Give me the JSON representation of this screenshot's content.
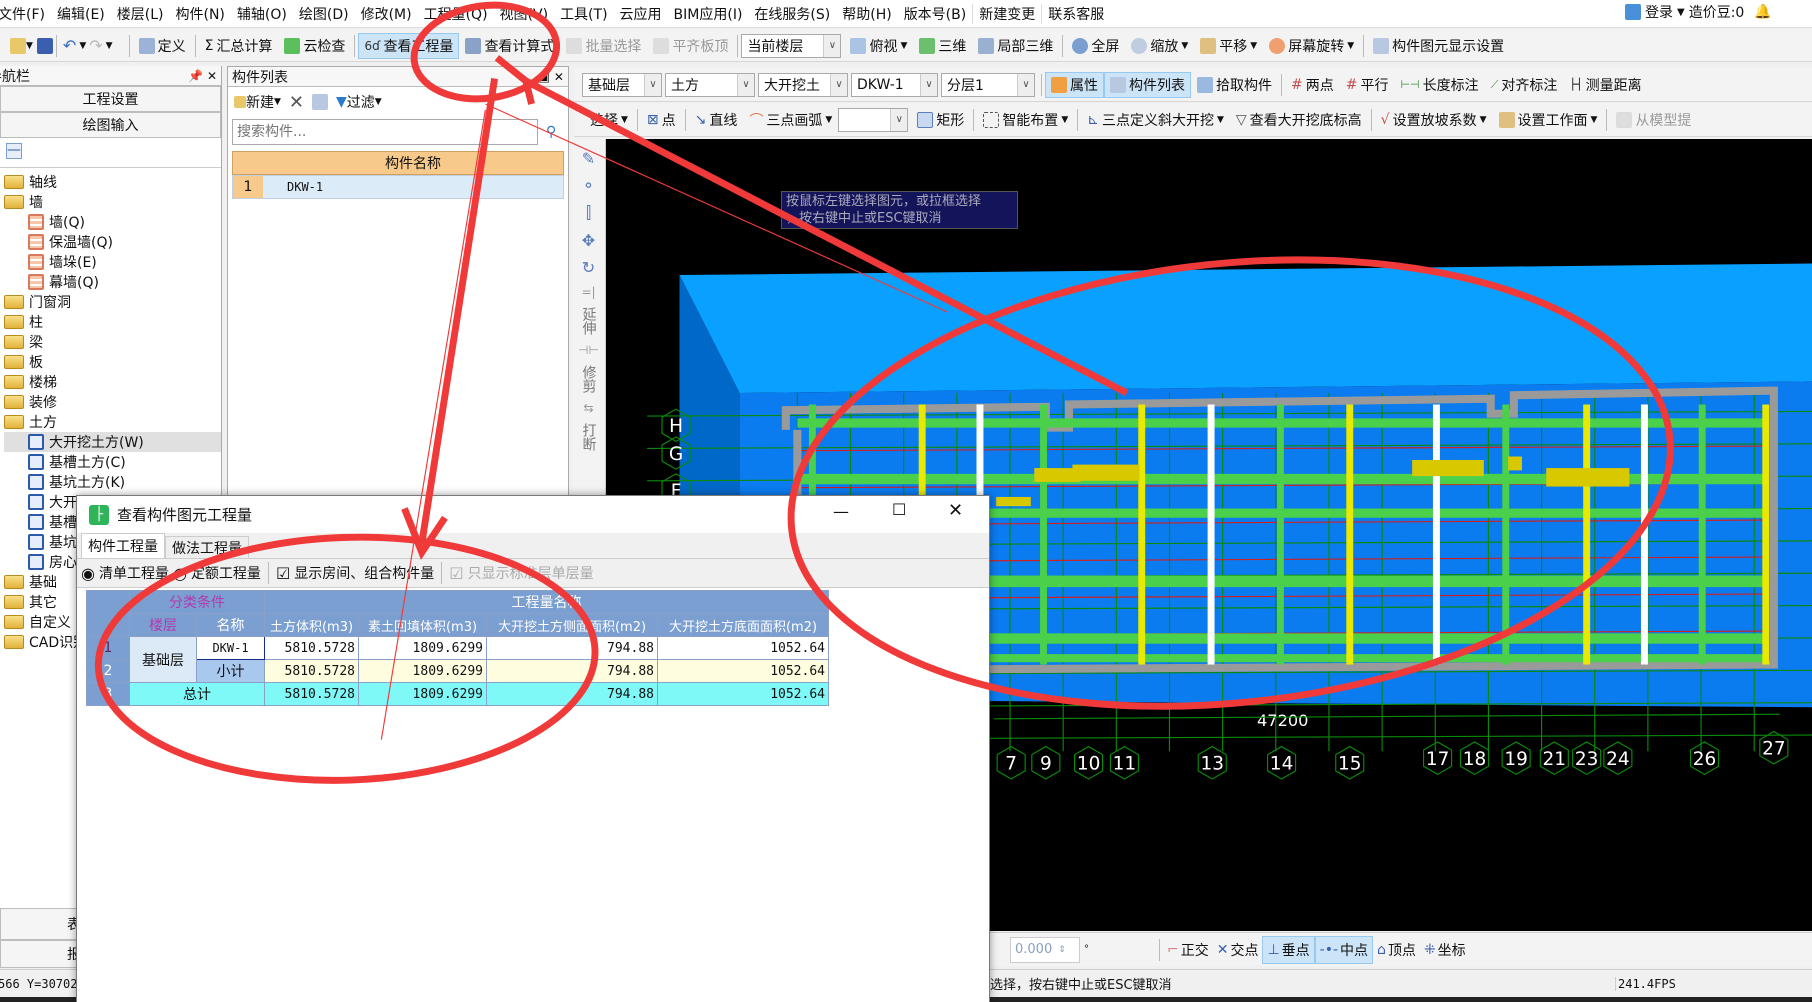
{
  "menu": [
    "文件(F)",
    "编辑(E)",
    "楼层(L)",
    "构件(N)",
    "辅轴(O)",
    "绘图(D)",
    "修改(M)",
    "工程量(Q)",
    "视图(V)",
    "工具(T)",
    "云应用",
    "BIM应用(I)",
    "在线服务(S)",
    "帮助(H)",
    "版本号(B)",
    "新建变更",
    "联系客服"
  ],
  "account": {
    "login": "登录",
    "beans": "造价豆:0"
  },
  "toolbar1": {
    "define": "定义",
    "sum": "汇总计算",
    "cloud_check": "云检查",
    "view_qty": "查看工程量",
    "view_formula": "查看计算式",
    "batch_select": "批量选择",
    "align_top": "平齐板顶",
    "floor_select": "当前楼层",
    "top_view": "俯视",
    "three_d": "三维",
    "partial_3d": "局部三维",
    "fullscreen": "全屏",
    "zoom": "缩放",
    "pan": "平移",
    "rotate": "屏幕旋转",
    "display_settings": "构件图元显示设置"
  },
  "toolbar2": {
    "floor": "基础层",
    "type": "土方",
    "subtype": "大开挖土",
    "component": "DKW-1",
    "layer": "分层1",
    "property": "属性",
    "component_list": "构件列表",
    "pick": "拾取构件",
    "two_points": "两点",
    "parallel": "平行",
    "length_dim": "长度标注",
    "align_dim": "对齐标注",
    "measure": "测量距离"
  },
  "toolbar3": {
    "select": "选择",
    "point": "点",
    "line": "直线",
    "arc": "三点画弧",
    "rect": "矩形",
    "smart": "智能布置",
    "slope": "三点定义斜大开挖",
    "view_bottom": "查看大开挖底标高",
    "slope_coef": "设置放坡系数",
    "work_face": "设置工作面",
    "from_model": "从模型提"
  },
  "nav": {
    "title": "模块导航栏",
    "project_settings": "工程设置",
    "drawing_input": "绘图输入",
    "tree": [
      {
        "label": "轴线",
        "level": 0,
        "kind": "folder"
      },
      {
        "label": "墙",
        "level": 0,
        "kind": "folder"
      },
      {
        "label": "墙(Q)",
        "level": 1,
        "kind": "wall"
      },
      {
        "label": "保温墙(Q)",
        "level": 1,
        "kind": "wall"
      },
      {
        "label": "墙垛(E)",
        "level": 1,
        "kind": "wall"
      },
      {
        "label": "幕墙(Q)",
        "level": 1,
        "kind": "wall"
      },
      {
        "label": "门窗洞",
        "level": 0,
        "kind": "folder"
      },
      {
        "label": "柱",
        "level": 0,
        "kind": "folder"
      },
      {
        "label": "梁",
        "level": 0,
        "kind": "folder"
      },
      {
        "label": "板",
        "level": 0,
        "kind": "folder"
      },
      {
        "label": "楼梯",
        "level": 0,
        "kind": "folder"
      },
      {
        "label": "装修",
        "level": 0,
        "kind": "folder"
      },
      {
        "label": "土方",
        "level": 0,
        "kind": "folder"
      },
      {
        "label": "大开挖土方(W)",
        "level": 1,
        "kind": "leaf",
        "selected": true
      },
      {
        "label": "基槽土方(C)",
        "level": 1,
        "kind": "leaf"
      },
      {
        "label": "基坑土方(K)",
        "level": 1,
        "kind": "leaf"
      },
      {
        "label": "大开",
        "level": 1,
        "kind": "leaf"
      },
      {
        "label": "基槽",
        "level": 1,
        "kind": "leaf"
      },
      {
        "label": "基坑",
        "level": 1,
        "kind": "leaf"
      },
      {
        "label": "房心",
        "level": 1,
        "kind": "leaf"
      },
      {
        "label": "基础",
        "level": 0,
        "kind": "folder"
      },
      {
        "label": "其它",
        "level": 0,
        "kind": "folder"
      },
      {
        "label": "自定义",
        "level": 0,
        "kind": "folder"
      },
      {
        "label": "CAD识别",
        "level": 0,
        "kind": "folder"
      }
    ],
    "bottom_buttons": [
      "表",
      "报"
    ],
    "coords": "566 Y=30702"
  },
  "component_list": {
    "title": "构件列表",
    "new": "新建",
    "filter": "过滤",
    "search_placeholder": "搜索构件...",
    "header": "构件名称",
    "rows": [
      {
        "no": "1",
        "name": "DKW-1"
      }
    ]
  },
  "side_tools": {
    "extend": "延伸",
    "trim": "修剪",
    "break": "打断"
  },
  "canvas": {
    "tooltip_line1": "按鼠标左键选择图元，或拉框选择",
    "tooltip_line2": "，按右键中止或ESC键取消",
    "axis_left": [
      "H",
      "G",
      "F"
    ],
    "axis_bottom": [
      "7",
      "9",
      "10",
      "11",
      "13",
      "14",
      "15",
      "17",
      "18",
      "19",
      "21",
      "23",
      "24",
      "26",
      "27"
    ],
    "dimension": "47200"
  },
  "snap": {
    "angle": "0.000",
    "ortho": "正交",
    "intersection": "交点",
    "perpendicular": "垂点",
    "midpoint": "中点",
    "vertex": "顶点",
    "coordinate": "坐标"
  },
  "status": {
    "message": "选择，按右键中止或ESC键取消",
    "fps": "241.4FPS"
  },
  "dialog": {
    "title": "查看构件图元工程量",
    "tabs": [
      "构件工程量",
      "做法工程量"
    ],
    "opt_list": "清单工程量",
    "opt_quota": "定额工程量",
    "opt_show_room": "显示房间、组合构件量",
    "opt_std_floor": "只显示标准层单层量",
    "table": {
      "group_cond": "分类条件",
      "group_qty": "工程量名称",
      "col_floor": "楼层",
      "col_name": "名称",
      "cols": [
        "土方体积(m3)",
        "素土回填体积(m3)",
        "大开挖土方侧面面积(m2)",
        "大开挖土方底面面积(m2)"
      ],
      "floor": "基础层",
      "total_label": "总计",
      "rows": [
        {
          "no": "1",
          "name": "DKW-1",
          "vals": [
            "5810.5728",
            "1809.6299",
            "794.88",
            "1052.64"
          ]
        },
        {
          "no": "2",
          "name": "小计",
          "vals": [
            "5810.5728",
            "1809.6299",
            "794.88",
            "1052.64"
          ]
        },
        {
          "no": "3",
          "name": "总计",
          "vals": [
            "5810.5728",
            "1809.6299",
            "794.88",
            "1052.64"
          ]
        }
      ]
    }
  },
  "colors": {
    "annotation": "#f03a3a",
    "active": "#cce4f7",
    "table_header": "#7b9fd0",
    "subtotal": "#fffde0",
    "total": "#7ff8f8"
  }
}
